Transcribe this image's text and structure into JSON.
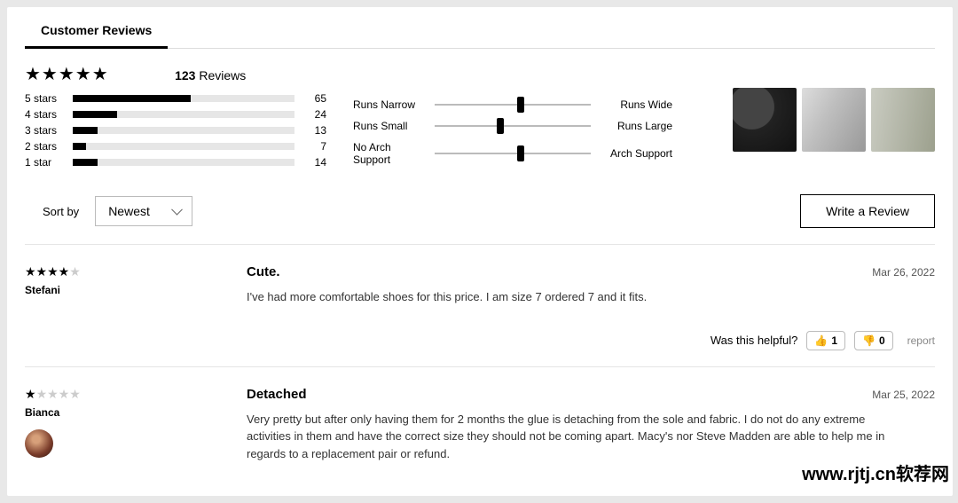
{
  "tab_label": "Customer Reviews",
  "overall_stars": 5,
  "review_count": "123",
  "review_count_suffix": "Reviews",
  "breakdown": [
    {
      "label": "5 stars",
      "count": 65,
      "pct": 53
    },
    {
      "label": "4 stars",
      "count": 24,
      "pct": 20
    },
    {
      "label": "3 stars",
      "count": 13,
      "pct": 11
    },
    {
      "label": "2 stars",
      "count": 7,
      "pct": 6
    },
    {
      "label": "1 star",
      "count": 14,
      "pct": 11
    }
  ],
  "fit": [
    {
      "left": "Runs Narrow",
      "right": "Runs Wide",
      "pos": 55
    },
    {
      "left": "Runs Small",
      "right": "Runs Large",
      "pos": 42
    },
    {
      "left": "No Arch Support",
      "right": "Arch Support",
      "pos": 55
    }
  ],
  "sort_label": "Sort by",
  "sort_value": "Newest",
  "write_review": "Write a Review",
  "helpful_prompt": "Was this helpful?",
  "report_label": "report",
  "reviews": [
    {
      "stars": 4,
      "author": "Stefani",
      "title": "Cute.",
      "date": "Mar 26, 2022",
      "body": "I've had more comfortable shoes for this price. I am size 7 ordered 7 and it fits.",
      "up": 1,
      "down": 0,
      "has_avatar": false
    },
    {
      "stars": 1,
      "author": "Bianca",
      "title": "Detached",
      "date": "Mar 25, 2022",
      "body": "Very pretty but after only having them for 2 months the glue is detaching from the sole and fabric. I do not do any extreme activities in them and have the correct size they should not be coming apart. Macy's nor Steve Madden are able to help me in regards to a replacement pair or refund.",
      "up": null,
      "down": null,
      "has_avatar": true
    }
  ],
  "watermark": "www.rjtj.cn软荐网"
}
